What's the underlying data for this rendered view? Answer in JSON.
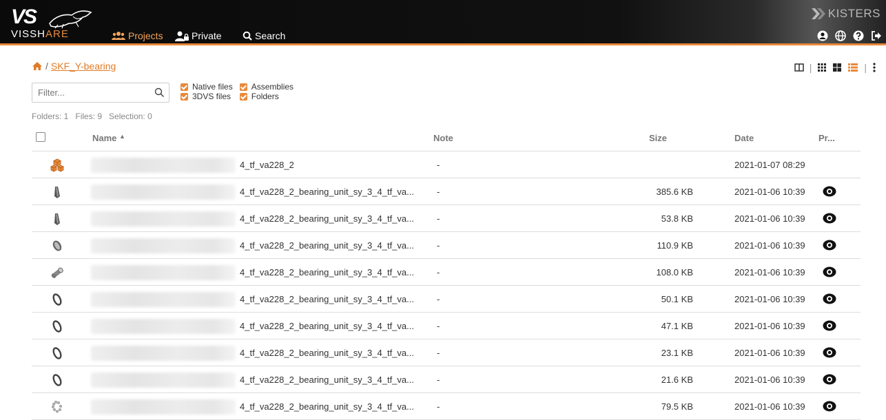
{
  "header": {
    "logo_text_white": "VISSH",
    "logo_text_orange": "ARE",
    "logo_mark": "VS",
    "brand": "KISTERS",
    "nav": {
      "projects": "Projects",
      "private": "Private",
      "search": "Search"
    }
  },
  "breadcrumb": {
    "separator": "/",
    "current": "SKF_Y-bearing"
  },
  "filter": {
    "placeholder": "Filter..."
  },
  "checkboxes": {
    "native": "Native files",
    "assemblies": "Assemblies",
    "threedvs": "3DVS files",
    "folders": "Folders"
  },
  "stats": {
    "folders": "Folders: 1",
    "files": "Files: 9",
    "selection": "Selection: 0"
  },
  "table": {
    "headers": {
      "name": "Name",
      "note": "Note",
      "size": "Size",
      "date": "Date",
      "pr": "Pr..."
    },
    "rows": [
      {
        "icon": "assembly-icon",
        "name": "4_tf_va228_2",
        "note": "-",
        "size": "",
        "date": "2021-01-07 08:29",
        "preview": false
      },
      {
        "icon": "part-pin-icon",
        "name": "4_tf_va228_2_bearing_unit_sy_3_4_tf_va...",
        "note": "-",
        "size": "385.6 KB",
        "date": "2021-01-06 10:39",
        "preview": true
      },
      {
        "icon": "part-pin-icon",
        "name": "4_tf_va228_2_bearing_unit_sy_3_4_tf_va...",
        "note": "-",
        "size": "53.8 KB",
        "date": "2021-01-06 10:39",
        "preview": true
      },
      {
        "icon": "part-ring-icon",
        "name": "4_tf_va228_2_bearing_unit_sy_3_4_tf_va...",
        "note": "-",
        "size": "110.9 KB",
        "date": "2021-01-06 10:39",
        "preview": true
      },
      {
        "icon": "part-cylinder-icon",
        "name": "4_tf_va228_2_bearing_unit_sy_3_4_tf_va...",
        "note": "-",
        "size": "108.0 KB",
        "date": "2021-01-06 10:39",
        "preview": true
      },
      {
        "icon": "part-thin-ring-icon",
        "name": "4_tf_va228_2_bearing_unit_sy_3_4_tf_va...",
        "note": "-",
        "size": "50.1 KB",
        "date": "2021-01-06 10:39",
        "preview": true
      },
      {
        "icon": "part-thin-ring-icon",
        "name": "4_tf_va228_2_bearing_unit_sy_3_4_tf_va...",
        "note": "-",
        "size": "47.1 KB",
        "date": "2021-01-06 10:39",
        "preview": true
      },
      {
        "icon": "part-thin-ring-icon",
        "name": "4_tf_va228_2_bearing_unit_sy_3_4_tf_va...",
        "note": "-",
        "size": "23.1 KB",
        "date": "2021-01-06 10:39",
        "preview": true
      },
      {
        "icon": "part-thin-ring-icon",
        "name": "4_tf_va228_2_bearing_unit_sy_3_4_tf_va...",
        "note": "-",
        "size": "21.6 KB",
        "date": "2021-01-06 10:39",
        "preview": true
      },
      {
        "icon": "part-balls-icon",
        "name": "4_tf_va228_2_bearing_unit_sy_3_4_tf_va...",
        "note": "-",
        "size": "79.5 KB",
        "date": "2021-01-06 10:39",
        "preview": true
      }
    ]
  },
  "colors": {
    "accent": "#e8893a",
    "topbar": "#0a0a0a",
    "link": "#e07b27"
  }
}
